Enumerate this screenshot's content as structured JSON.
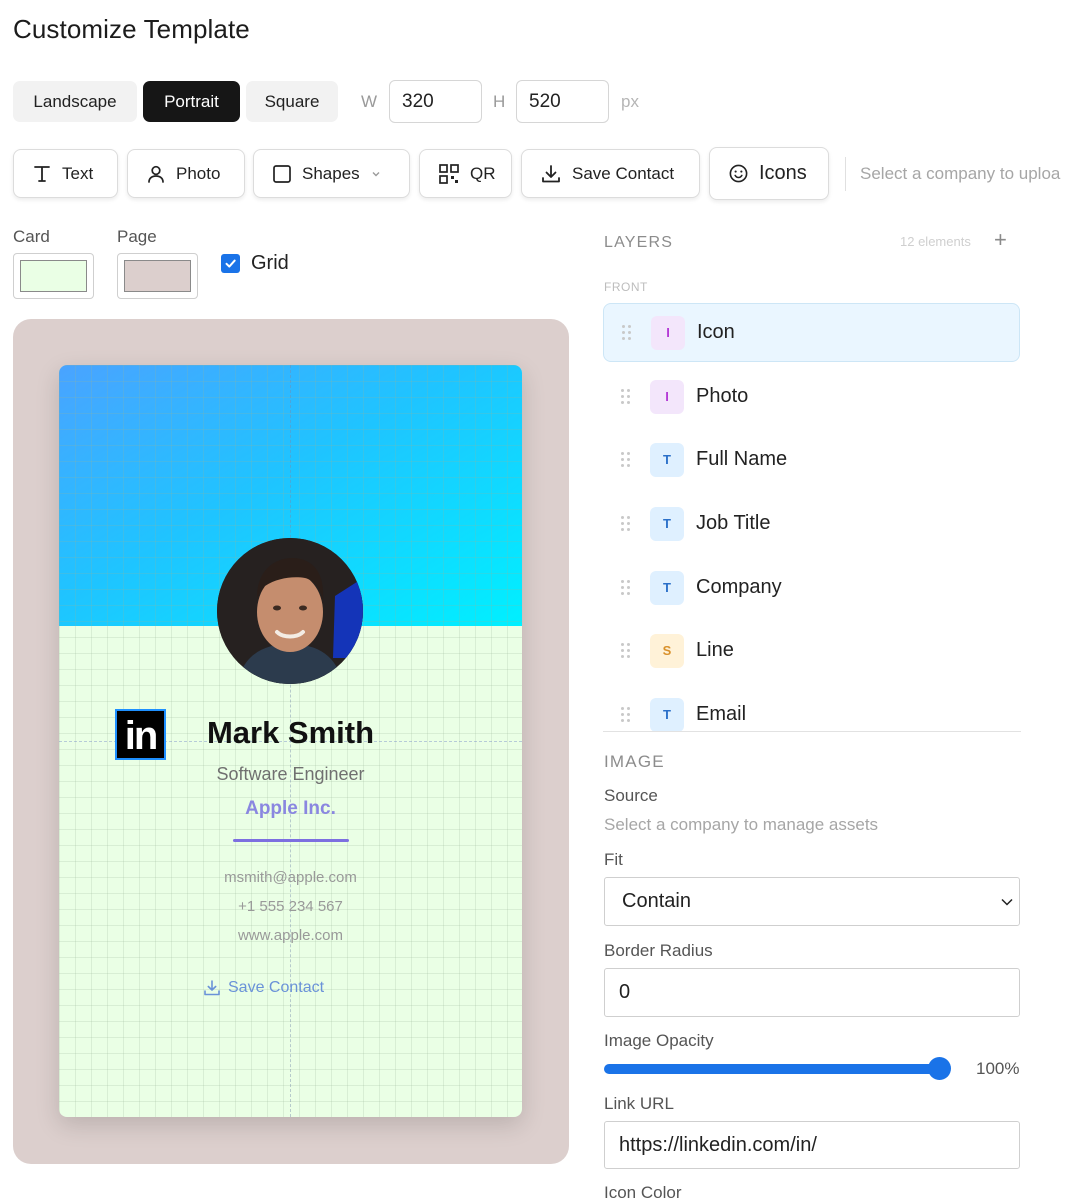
{
  "page_title": "Customize Template",
  "orientation": {
    "options": [
      "Landscape",
      "Portrait",
      "Square"
    ],
    "selected": "Portrait"
  },
  "dimensions": {
    "w_label": "W",
    "w_value": "320",
    "h_label": "H",
    "h_value": "520",
    "unit": "px"
  },
  "toolbar": {
    "text": "Text",
    "photo": "Photo",
    "shapes": "Shapes",
    "qr": "QR",
    "save_contact": "Save Contact",
    "icons": "Icons",
    "hint": "Select a company to uploa"
  },
  "colors": {
    "card_label": "Card",
    "card_color": "#eaffe5",
    "page_label": "Page",
    "page_color": "#dccfcd",
    "grid_label": "Grid",
    "grid_checked": true
  },
  "card": {
    "name": "Mark Smith",
    "job_title": "Software Engineer",
    "company": "Apple Inc.",
    "email": "msmith@apple.com",
    "phone": "+1 555 234 567",
    "website": "www.apple.com",
    "save_contact": "Save Contact",
    "icon_glyph": "in",
    "header_colors": [
      "#4aa3ff",
      "#00f0ff"
    ],
    "accent_color": "#8a87e0"
  },
  "layers": {
    "title": "LAYERS",
    "count": "12 elements",
    "group": "FRONT",
    "items": [
      {
        "type": "I",
        "label": "Icon",
        "selected": true
      },
      {
        "type": "I",
        "label": "Photo"
      },
      {
        "type": "T",
        "label": "Full Name"
      },
      {
        "type": "T",
        "label": "Job Title"
      },
      {
        "type": "T",
        "label": "Company"
      },
      {
        "type": "S",
        "label": "Line"
      },
      {
        "type": "T",
        "label": "Email"
      }
    ]
  },
  "image": {
    "section": "IMAGE",
    "source_label": "Source",
    "source_hint": "Select a company to manage assets",
    "fit_label": "Fit",
    "fit_value": "Contain",
    "border_radius_label": "Border Radius",
    "border_radius_value": "0",
    "opacity_label": "Image Opacity",
    "opacity_value": "100%",
    "opacity_fraction": 1.0,
    "link_label": "Link URL",
    "link_value": "https://linkedin.com/in/",
    "icon_color_label": "Icon Color"
  }
}
